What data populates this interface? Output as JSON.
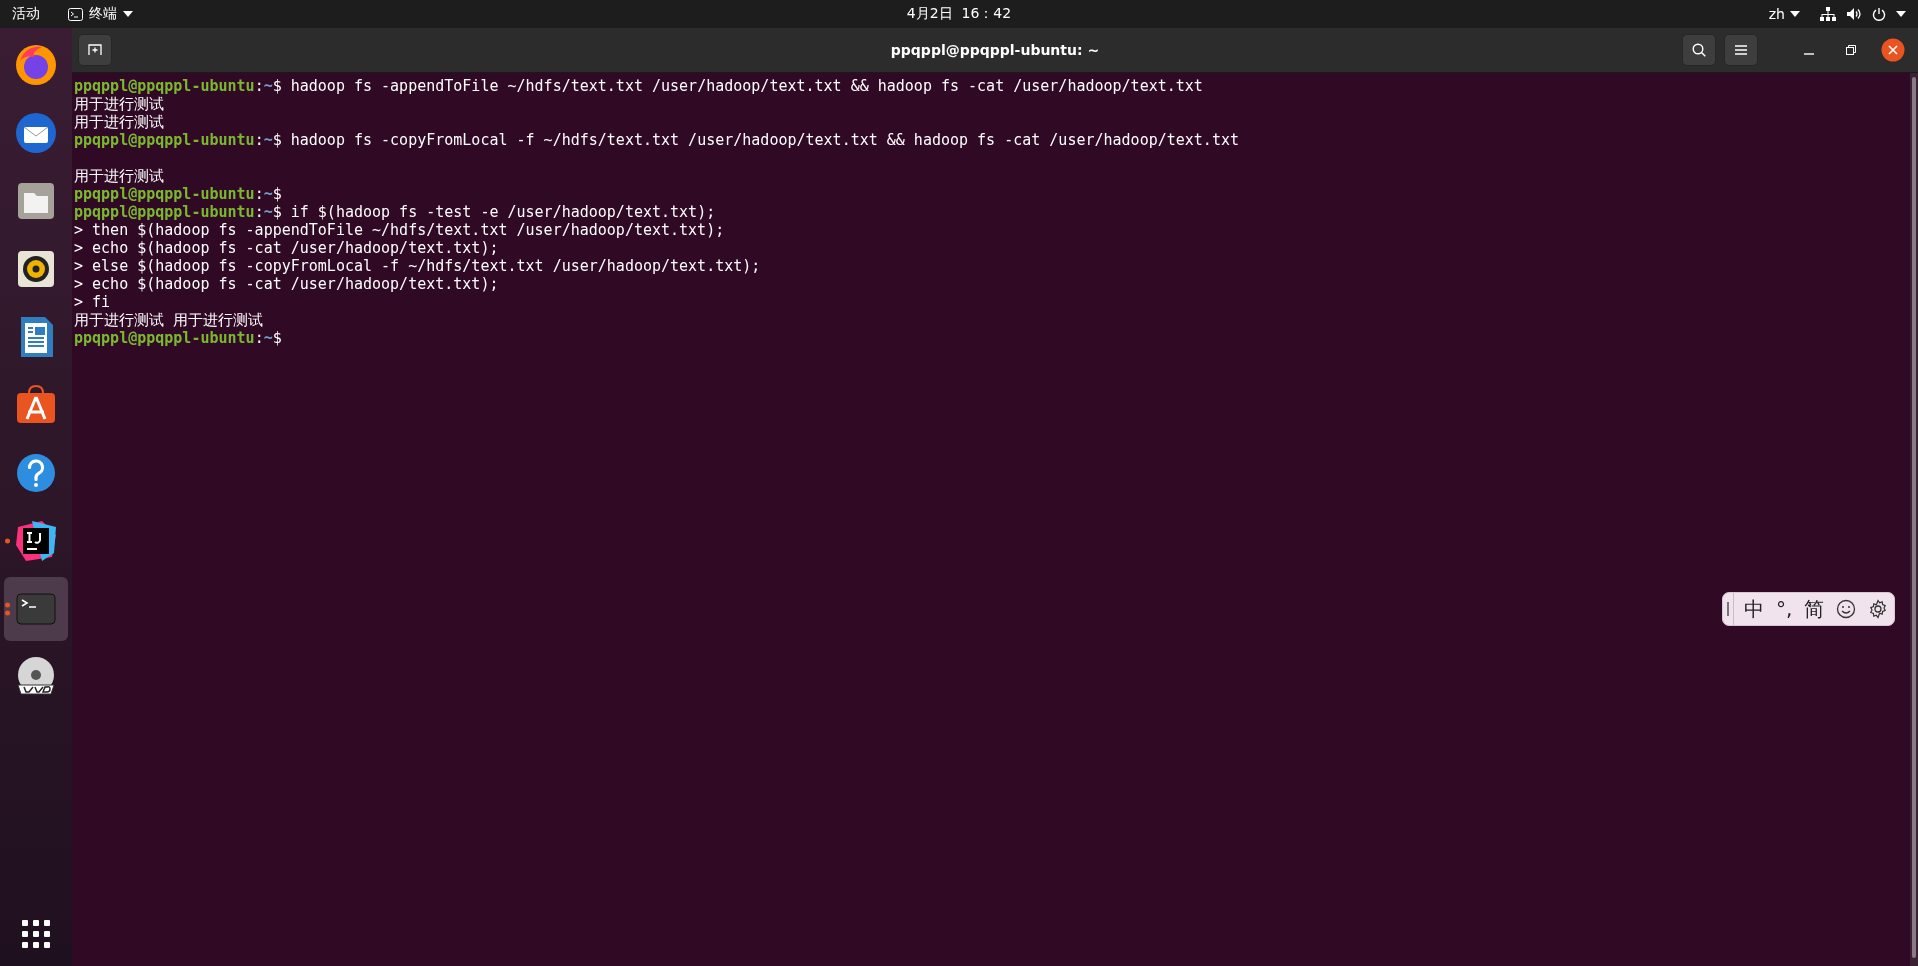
{
  "top_bar": {
    "activities": "活动",
    "app_menu": "终端",
    "clock": "4月2日  16：42",
    "input_language": "zh"
  },
  "dock": {
    "items": [
      {
        "kind": "firefox",
        "running": false,
        "selected": false
      },
      {
        "kind": "thunderbird",
        "running": false,
        "selected": false
      },
      {
        "kind": "files",
        "running": false,
        "selected": false
      },
      {
        "kind": "rhythmbox",
        "running": false,
        "selected": false
      },
      {
        "kind": "writer",
        "running": false,
        "selected": false
      },
      {
        "kind": "software",
        "running": false,
        "selected": false
      },
      {
        "kind": "help",
        "running": false,
        "selected": false
      },
      {
        "kind": "intellij",
        "running": true,
        "selected": false
      },
      {
        "kind": "terminal",
        "running": true,
        "selected": true
      },
      {
        "kind": "dvd",
        "running": false,
        "selected": false
      }
    ]
  },
  "window": {
    "title": "ppqppl@ppqppl-ubuntu: ~"
  },
  "terminal": {
    "lines": [
      {
        "kind": "prompt",
        "user_host": "ppqppl@ppqppl-ubuntu",
        "separator": ":",
        "cwd": "~",
        "symbol": "$",
        "command": "hadoop fs -appendToFile ~/hdfs/text.txt /user/hadoop/text.txt && hadoop fs -cat /user/hadoop/text.txt"
      },
      {
        "kind": "output",
        "text": "用于进行测试"
      },
      {
        "kind": "output",
        "text": "用于进行测试"
      },
      {
        "kind": "prompt",
        "user_host": "ppqppl@ppqppl-ubuntu",
        "separator": ":",
        "cwd": "~",
        "symbol": "$",
        "command": "hadoop fs -copyFromLocal -f ~/hdfs/text.txt /user/hadoop/text.txt && hadoop fs -cat /user/hadoop/text.txt"
      },
      {
        "kind": "blank"
      },
      {
        "kind": "output",
        "text": "用于进行测试"
      },
      {
        "kind": "prompt",
        "user_host": "ppqppl@ppqppl-ubuntu",
        "separator": ":",
        "cwd": "~",
        "symbol": "$"
      },
      {
        "kind": "prompt",
        "user_host": "ppqppl@ppqppl-ubuntu",
        "separator": ":",
        "cwd": "~",
        "symbol": "$",
        "command": "if $(hadoop fs -test -e /user/hadoop/text.txt);"
      },
      {
        "kind": "output",
        "text": "> then $(hadoop fs -appendToFile ~/hdfs/text.txt /user/hadoop/text.txt);"
      },
      {
        "kind": "output",
        "text": "> echo $(hadoop fs -cat /user/hadoop/text.txt);"
      },
      {
        "kind": "output",
        "text": "> else $(hadoop fs -copyFromLocal -f ~/hdfs/text.txt /user/hadoop/text.txt);"
      },
      {
        "kind": "output",
        "text": "> echo $(hadoop fs -cat /user/hadoop/text.txt);"
      },
      {
        "kind": "output",
        "text": "> fi"
      },
      {
        "kind": "output",
        "text": "用于进行测试 用于进行测试"
      },
      {
        "kind": "prompt",
        "user_host": "ppqppl@ppqppl-ubuntu",
        "separator": ":",
        "cwd": "~",
        "symbol": "$"
      }
    ]
  },
  "input_method_bar": {
    "mode": "中",
    "punctuation": "°,",
    "script": "简"
  }
}
